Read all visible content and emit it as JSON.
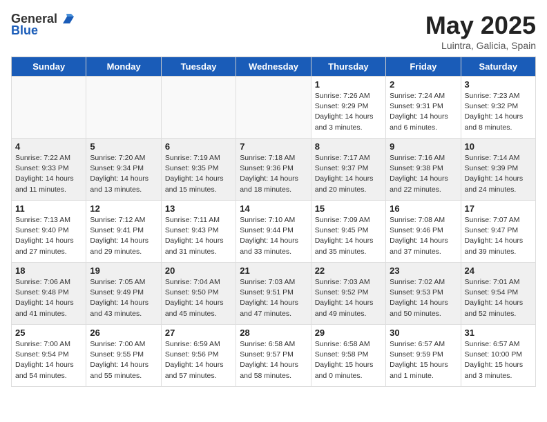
{
  "logo": {
    "general": "General",
    "blue": "Blue"
  },
  "title": "May 2025",
  "subtitle": "Luintra, Galicia, Spain",
  "days": [
    "Sunday",
    "Monday",
    "Tuesday",
    "Wednesday",
    "Thursday",
    "Friday",
    "Saturday"
  ],
  "weeks": [
    [
      {
        "num": "",
        "detail": "",
        "empty": true
      },
      {
        "num": "",
        "detail": "",
        "empty": true
      },
      {
        "num": "",
        "detail": "",
        "empty": true
      },
      {
        "num": "",
        "detail": "",
        "empty": true
      },
      {
        "num": "1",
        "detail": "Sunrise: 7:26 AM\nSunset: 9:29 PM\nDaylight: 14 hours\nand 3 minutes."
      },
      {
        "num": "2",
        "detail": "Sunrise: 7:24 AM\nSunset: 9:31 PM\nDaylight: 14 hours\nand 6 minutes."
      },
      {
        "num": "3",
        "detail": "Sunrise: 7:23 AM\nSunset: 9:32 PM\nDaylight: 14 hours\nand 8 minutes."
      }
    ],
    [
      {
        "num": "4",
        "detail": "Sunrise: 7:22 AM\nSunset: 9:33 PM\nDaylight: 14 hours\nand 11 minutes."
      },
      {
        "num": "5",
        "detail": "Sunrise: 7:20 AM\nSunset: 9:34 PM\nDaylight: 14 hours\nand 13 minutes."
      },
      {
        "num": "6",
        "detail": "Sunrise: 7:19 AM\nSunset: 9:35 PM\nDaylight: 14 hours\nand 15 minutes."
      },
      {
        "num": "7",
        "detail": "Sunrise: 7:18 AM\nSunset: 9:36 PM\nDaylight: 14 hours\nand 18 minutes."
      },
      {
        "num": "8",
        "detail": "Sunrise: 7:17 AM\nSunset: 9:37 PM\nDaylight: 14 hours\nand 20 minutes."
      },
      {
        "num": "9",
        "detail": "Sunrise: 7:16 AM\nSunset: 9:38 PM\nDaylight: 14 hours\nand 22 minutes."
      },
      {
        "num": "10",
        "detail": "Sunrise: 7:14 AM\nSunset: 9:39 PM\nDaylight: 14 hours\nand 24 minutes."
      }
    ],
    [
      {
        "num": "11",
        "detail": "Sunrise: 7:13 AM\nSunset: 9:40 PM\nDaylight: 14 hours\nand 27 minutes."
      },
      {
        "num": "12",
        "detail": "Sunrise: 7:12 AM\nSunset: 9:41 PM\nDaylight: 14 hours\nand 29 minutes."
      },
      {
        "num": "13",
        "detail": "Sunrise: 7:11 AM\nSunset: 9:43 PM\nDaylight: 14 hours\nand 31 minutes."
      },
      {
        "num": "14",
        "detail": "Sunrise: 7:10 AM\nSunset: 9:44 PM\nDaylight: 14 hours\nand 33 minutes."
      },
      {
        "num": "15",
        "detail": "Sunrise: 7:09 AM\nSunset: 9:45 PM\nDaylight: 14 hours\nand 35 minutes."
      },
      {
        "num": "16",
        "detail": "Sunrise: 7:08 AM\nSunset: 9:46 PM\nDaylight: 14 hours\nand 37 minutes."
      },
      {
        "num": "17",
        "detail": "Sunrise: 7:07 AM\nSunset: 9:47 PM\nDaylight: 14 hours\nand 39 minutes."
      }
    ],
    [
      {
        "num": "18",
        "detail": "Sunrise: 7:06 AM\nSunset: 9:48 PM\nDaylight: 14 hours\nand 41 minutes."
      },
      {
        "num": "19",
        "detail": "Sunrise: 7:05 AM\nSunset: 9:49 PM\nDaylight: 14 hours\nand 43 minutes."
      },
      {
        "num": "20",
        "detail": "Sunrise: 7:04 AM\nSunset: 9:50 PM\nDaylight: 14 hours\nand 45 minutes."
      },
      {
        "num": "21",
        "detail": "Sunrise: 7:03 AM\nSunset: 9:51 PM\nDaylight: 14 hours\nand 47 minutes."
      },
      {
        "num": "22",
        "detail": "Sunrise: 7:03 AM\nSunset: 9:52 PM\nDaylight: 14 hours\nand 49 minutes."
      },
      {
        "num": "23",
        "detail": "Sunrise: 7:02 AM\nSunset: 9:53 PM\nDaylight: 14 hours\nand 50 minutes."
      },
      {
        "num": "24",
        "detail": "Sunrise: 7:01 AM\nSunset: 9:54 PM\nDaylight: 14 hours\nand 52 minutes."
      }
    ],
    [
      {
        "num": "25",
        "detail": "Sunrise: 7:00 AM\nSunset: 9:54 PM\nDaylight: 14 hours\nand 54 minutes."
      },
      {
        "num": "26",
        "detail": "Sunrise: 7:00 AM\nSunset: 9:55 PM\nDaylight: 14 hours\nand 55 minutes."
      },
      {
        "num": "27",
        "detail": "Sunrise: 6:59 AM\nSunset: 9:56 PM\nDaylight: 14 hours\nand 57 minutes."
      },
      {
        "num": "28",
        "detail": "Sunrise: 6:58 AM\nSunset: 9:57 PM\nDaylight: 14 hours\nand 58 minutes."
      },
      {
        "num": "29",
        "detail": "Sunrise: 6:58 AM\nSunset: 9:58 PM\nDaylight: 15 hours\nand 0 minutes."
      },
      {
        "num": "30",
        "detail": "Sunrise: 6:57 AM\nSunset: 9:59 PM\nDaylight: 15 hours\nand 1 minute."
      },
      {
        "num": "31",
        "detail": "Sunrise: 6:57 AM\nSunset: 10:00 PM\nDaylight: 15 hours\nand 3 minutes."
      }
    ]
  ]
}
